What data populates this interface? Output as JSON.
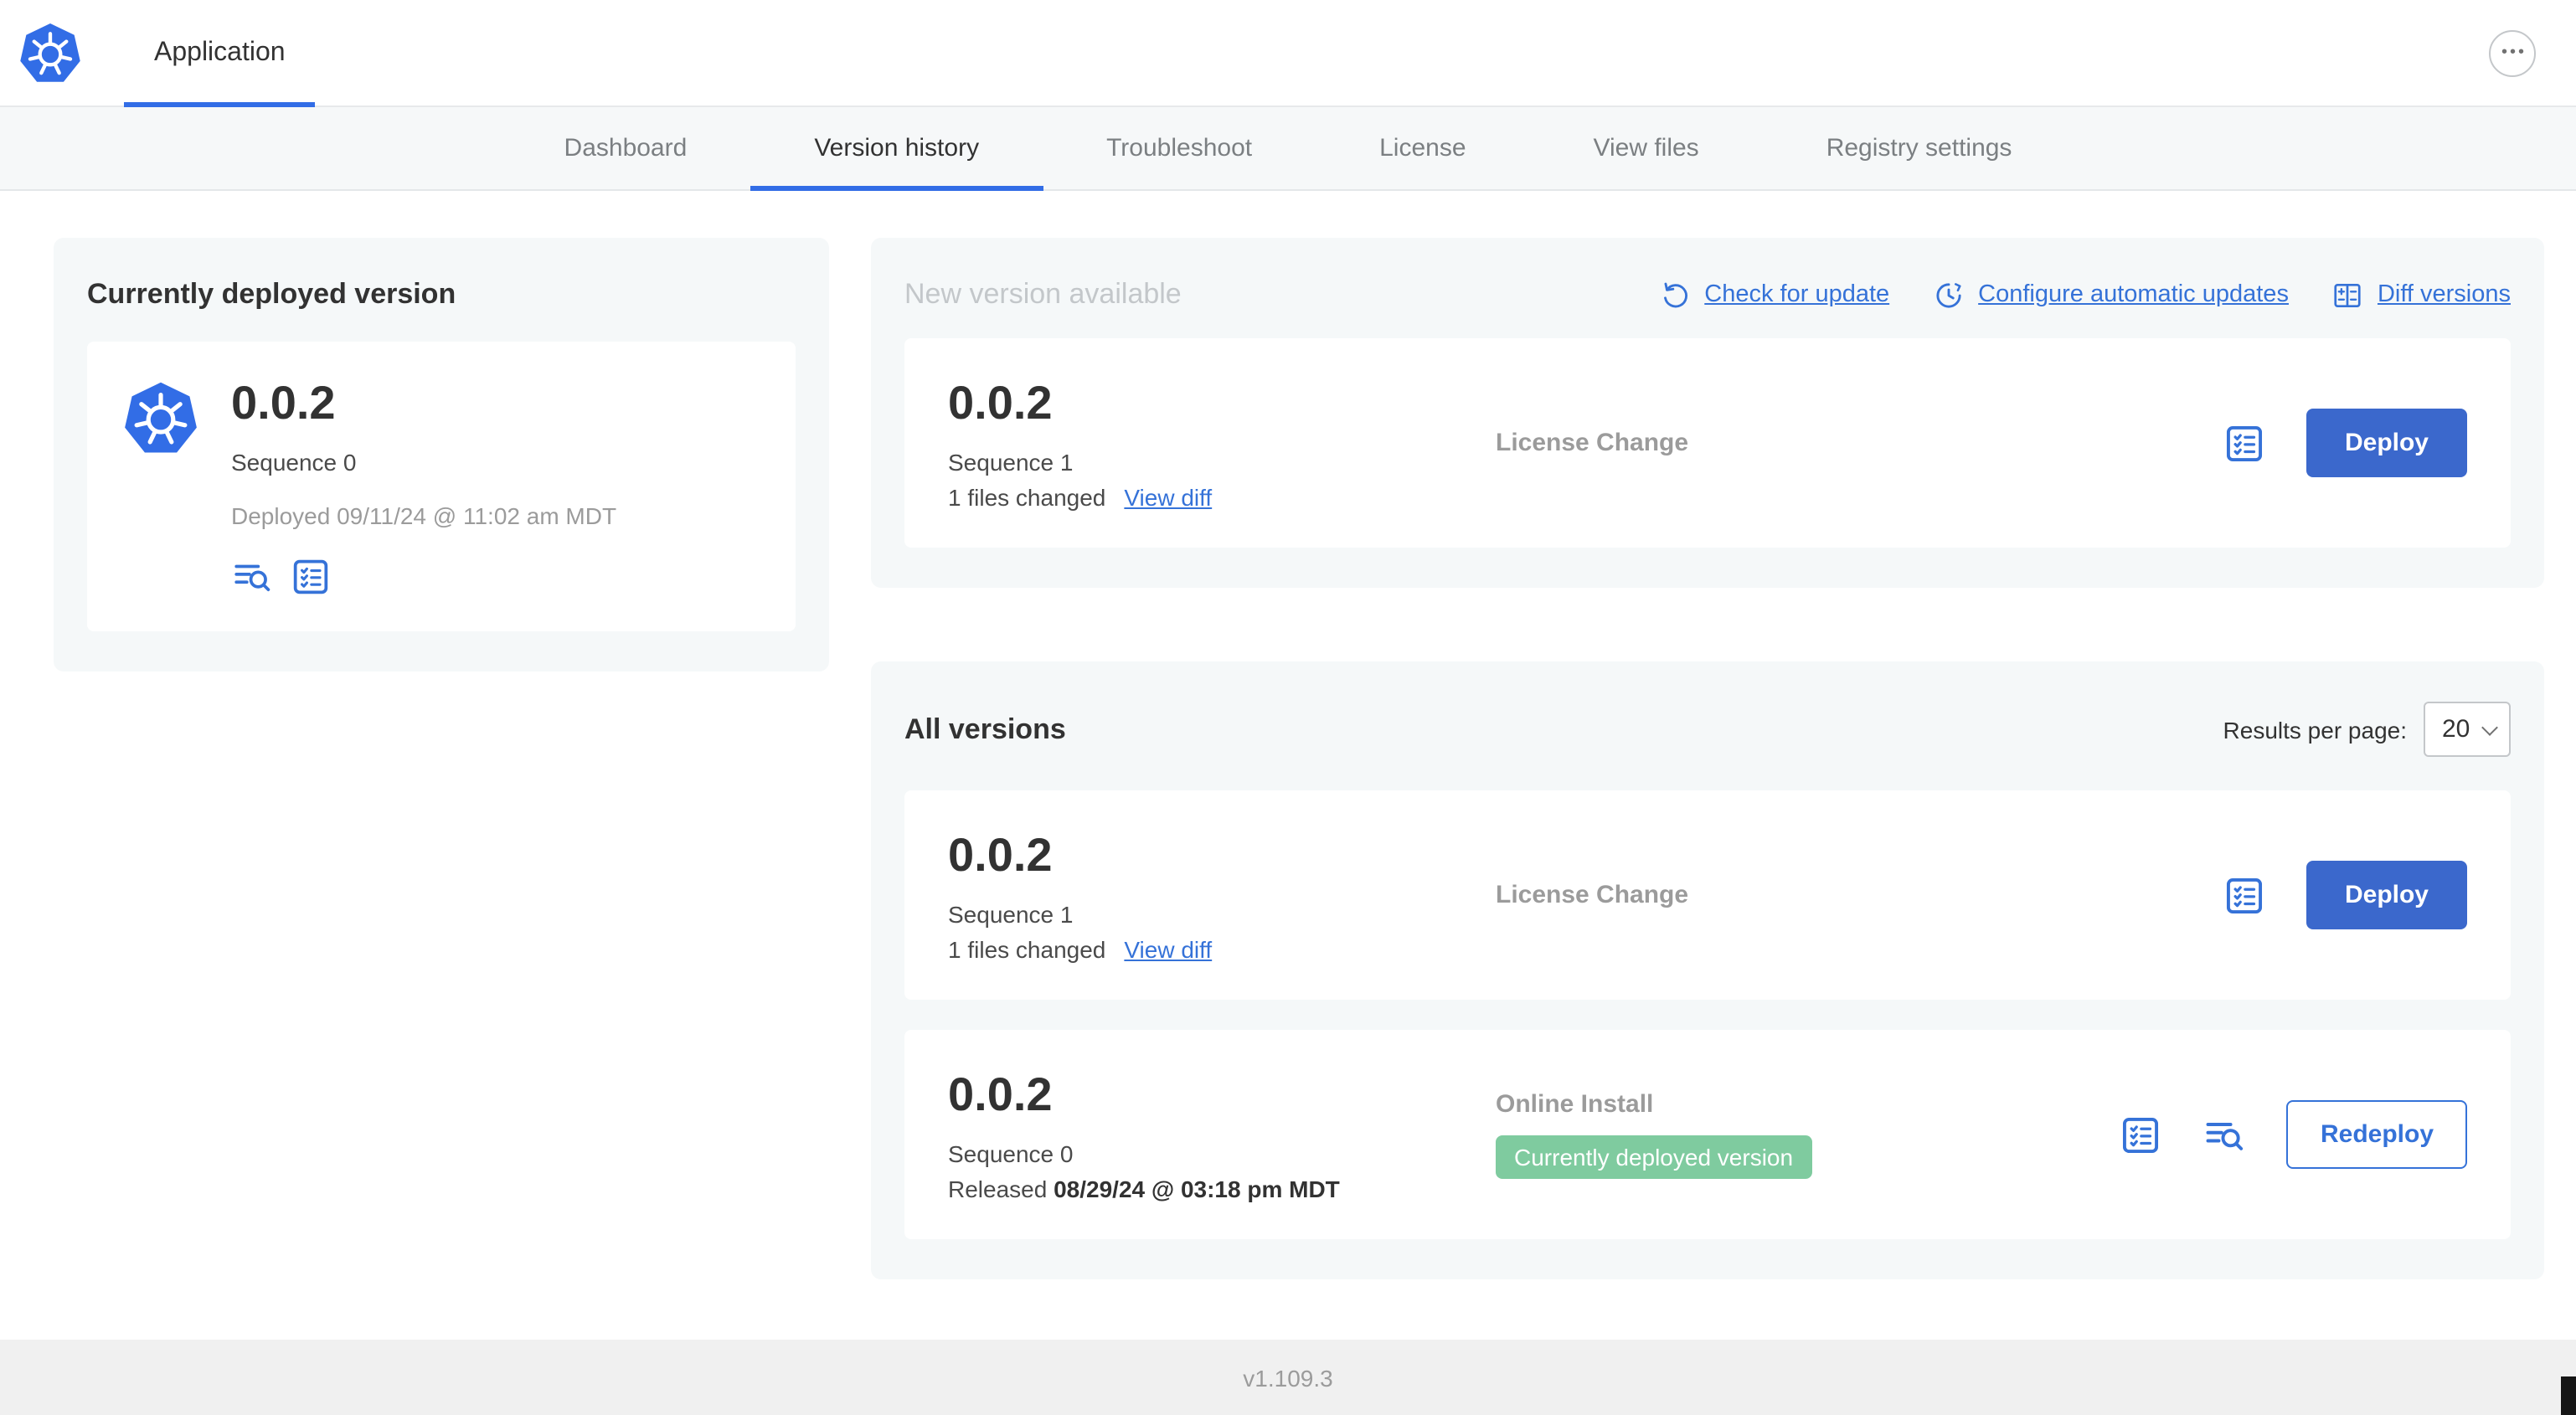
{
  "colors": {
    "kubernetes_blue": "#326de6",
    "link_blue": "#3572d8",
    "button_blue": "#3b68cc",
    "badge_green": "#7fcb9f",
    "panel_gray": "#f5f8f9"
  },
  "header": {
    "title": "Application"
  },
  "nav": {
    "active_tab": "Version history",
    "tabs": [
      {
        "label": "Dashboard"
      },
      {
        "label": "Version history"
      },
      {
        "label": "Troubleshoot"
      },
      {
        "label": "License"
      },
      {
        "label": "View files"
      },
      {
        "label": "Registry settings"
      }
    ]
  },
  "current_version": {
    "title": "Currently deployed version",
    "version": "0.0.2",
    "sequence": "Sequence 0",
    "deployed_text": "Deployed 09/11/24 @ 11:02 am MDT"
  },
  "new_version": {
    "title": "New version available",
    "actions": [
      {
        "label": "Check for update",
        "icon": "refresh-icon"
      },
      {
        "label": "Configure automatic updates",
        "icon": "automatic-updates-icon"
      },
      {
        "label": "Diff versions",
        "icon": "diff-icon"
      }
    ],
    "release": {
      "version": "0.0.2",
      "sequence": "Sequence 1",
      "files_changed": "1 files changed",
      "view_diff_label": "View diff",
      "source": "License Change",
      "deploy_label": "Deploy"
    }
  },
  "all_versions": {
    "title": "All versions",
    "results_per_page_label": "Results per page:",
    "results_per_page_value": "20",
    "rows": [
      {
        "version": "0.0.2",
        "sequence": "Sequence 1",
        "files_changed": "1 files changed",
        "view_diff_label": "View diff",
        "source": "License Change",
        "action_label": "Deploy"
      },
      {
        "version": "0.0.2",
        "sequence": "Sequence 0",
        "released_label": "Released",
        "released_date": "08/29/24 @ 03:18 pm MDT",
        "source": "Online Install",
        "badge": "Currently deployed version",
        "action_label": "Redeploy"
      }
    ]
  },
  "footer": {
    "app_version": "v1.109.3"
  }
}
